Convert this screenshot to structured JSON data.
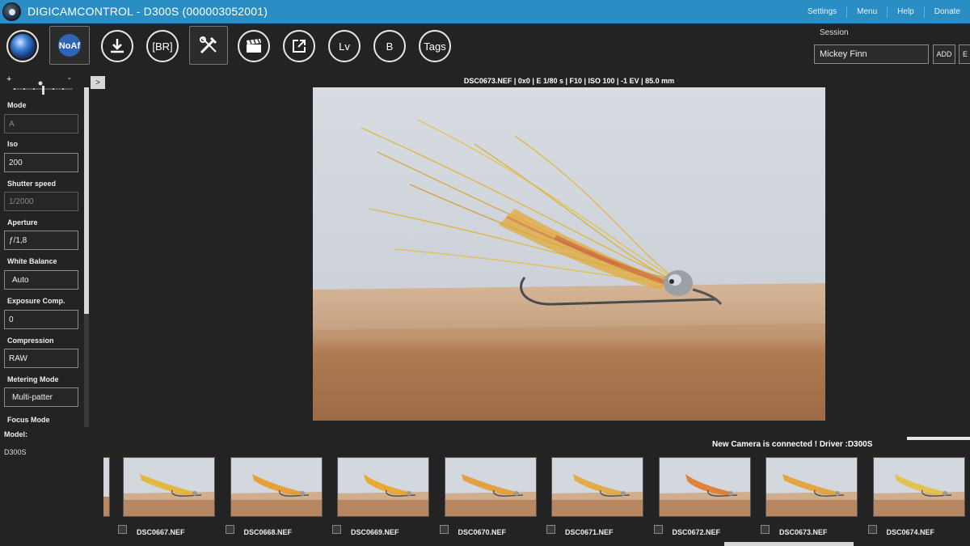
{
  "titlebar": {
    "title": "DIGICAMCONTROL - D300S (000003052001)",
    "menu": [
      "Settings",
      "Menu",
      "Help",
      "Donate"
    ]
  },
  "toolbar": {
    "buttons": [
      {
        "name": "capture-button",
        "label": "",
        "icon": "capture-icon"
      },
      {
        "name": "noaf-button",
        "label": "NoAf",
        "icon": "noaf-icon"
      },
      {
        "name": "download-button",
        "label": "",
        "icon": "download-icon"
      },
      {
        "name": "bracketing-button",
        "label": "[BR]",
        "icon": "bracket-icon"
      },
      {
        "name": "tools-button",
        "label": "",
        "icon": "tools-icon"
      },
      {
        "name": "movie-button",
        "label": "",
        "icon": "clapperboard-icon"
      },
      {
        "name": "external-button",
        "label": "",
        "icon": "external-link-icon"
      },
      {
        "name": "liveview-button",
        "label": "Lv",
        "icon": ""
      },
      {
        "name": "bulb-button",
        "label": "B",
        "icon": ""
      },
      {
        "name": "tags-button",
        "label": "Tags",
        "icon": ""
      }
    ]
  },
  "session": {
    "label": "Session",
    "value": "Mickey Finn",
    "add_label": "ADD",
    "edit_label": "E"
  },
  "zoom": {
    "minus_left": "+",
    "minus_right": "-"
  },
  "camera_properties": {
    "mode_label": "Mode",
    "mode_value": "A",
    "iso_label": "Iso",
    "iso_value": "200",
    "shutter_label": "Shutter speed",
    "shutter_value": "1/2000",
    "aperture_label": "Aperture",
    "aperture_value": "ƒ/1,8",
    "wb_label": "White Balance",
    "wb_value": "Auto",
    "exposure_label": "Exposure Comp.",
    "exposure_value": "0",
    "compression_label": "Compression",
    "compression_value": "RAW",
    "metering_label": "Metering Mode",
    "metering_value": "Multi-patter",
    "focus_label": "Focus Mode",
    "model_label": "Model:",
    "model_value": "D300S"
  },
  "preview": {
    "info": "DSC0673.NEF | 0x0 | E 1/80 s | F10 | ISO 100 | -1 EV | 85.0 mm"
  },
  "status": {
    "text": "New Camera is connected ! Driver :D300S"
  },
  "thumbnails": [
    {
      "file": "DSC0667.NEF"
    },
    {
      "file": "DSC0668.NEF"
    },
    {
      "file": "DSC0669.NEF"
    },
    {
      "file": "DSC0670.NEF"
    },
    {
      "file": "DSC0671.NEF"
    },
    {
      "file": "DSC0672.NEF"
    },
    {
      "file": "DSC0673.NEF"
    },
    {
      "file": "DSC0674.NEF"
    }
  ],
  "colors": {
    "titlebar": "#2a8ec4",
    "background": "#232323"
  }
}
